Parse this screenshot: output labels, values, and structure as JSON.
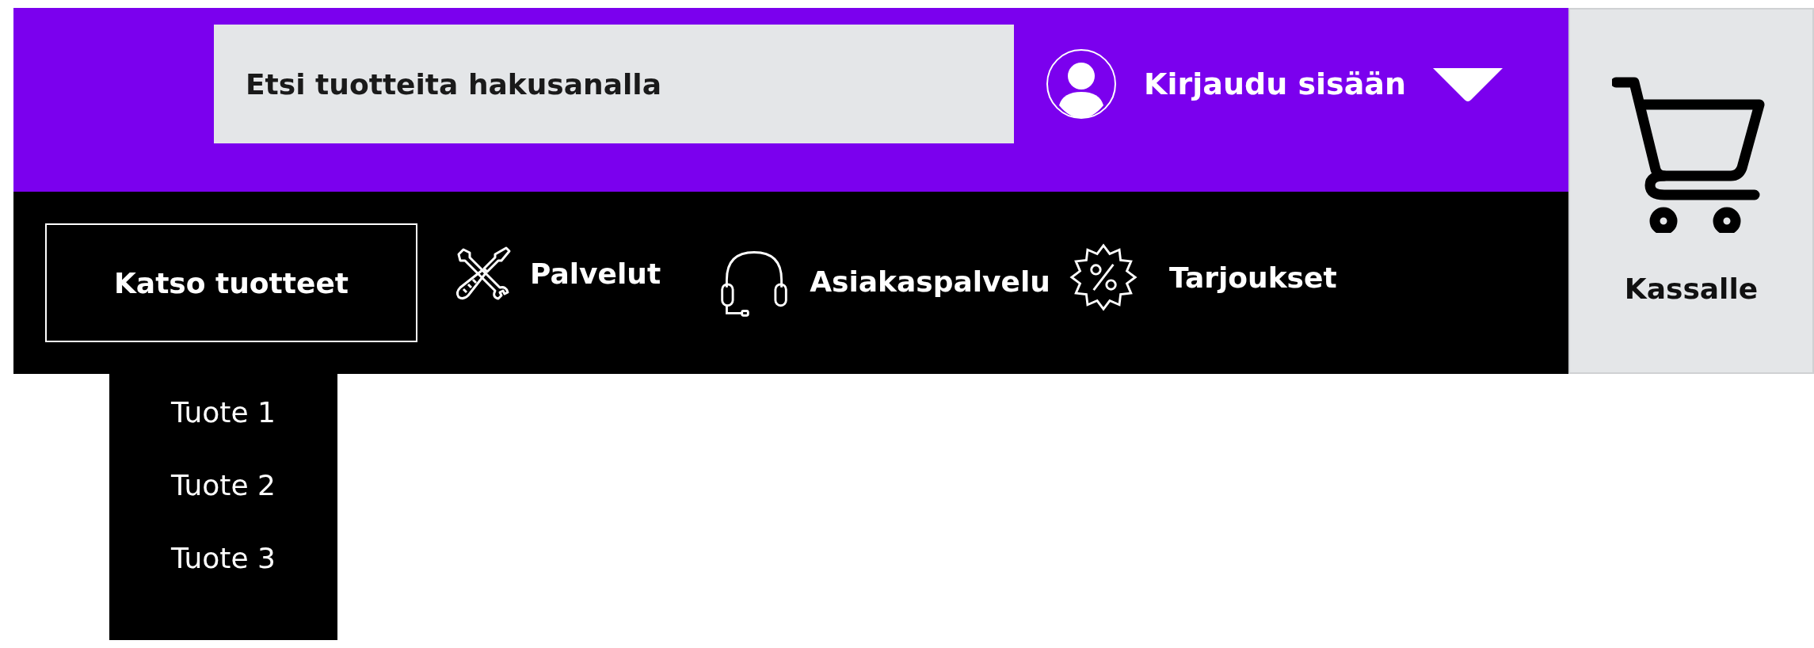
{
  "search": {
    "placeholder": "Etsi tuotteita hakusanalla"
  },
  "account": {
    "label": "Kirjaudu sisään"
  },
  "nav": [
    {
      "kind": "menu",
      "label": "Katso tuotteet",
      "expanded": true,
      "items": [
        "Tuote 1",
        "Tuote 2",
        "Tuote 3"
      ]
    },
    {
      "kind": "services",
      "label": "Palvelut"
    },
    {
      "kind": "support",
      "label": "Asiakaspalvelu"
    },
    {
      "kind": "offers",
      "label": "Tarjoukset"
    }
  ],
  "cart": {
    "label": "Kassalle"
  }
}
